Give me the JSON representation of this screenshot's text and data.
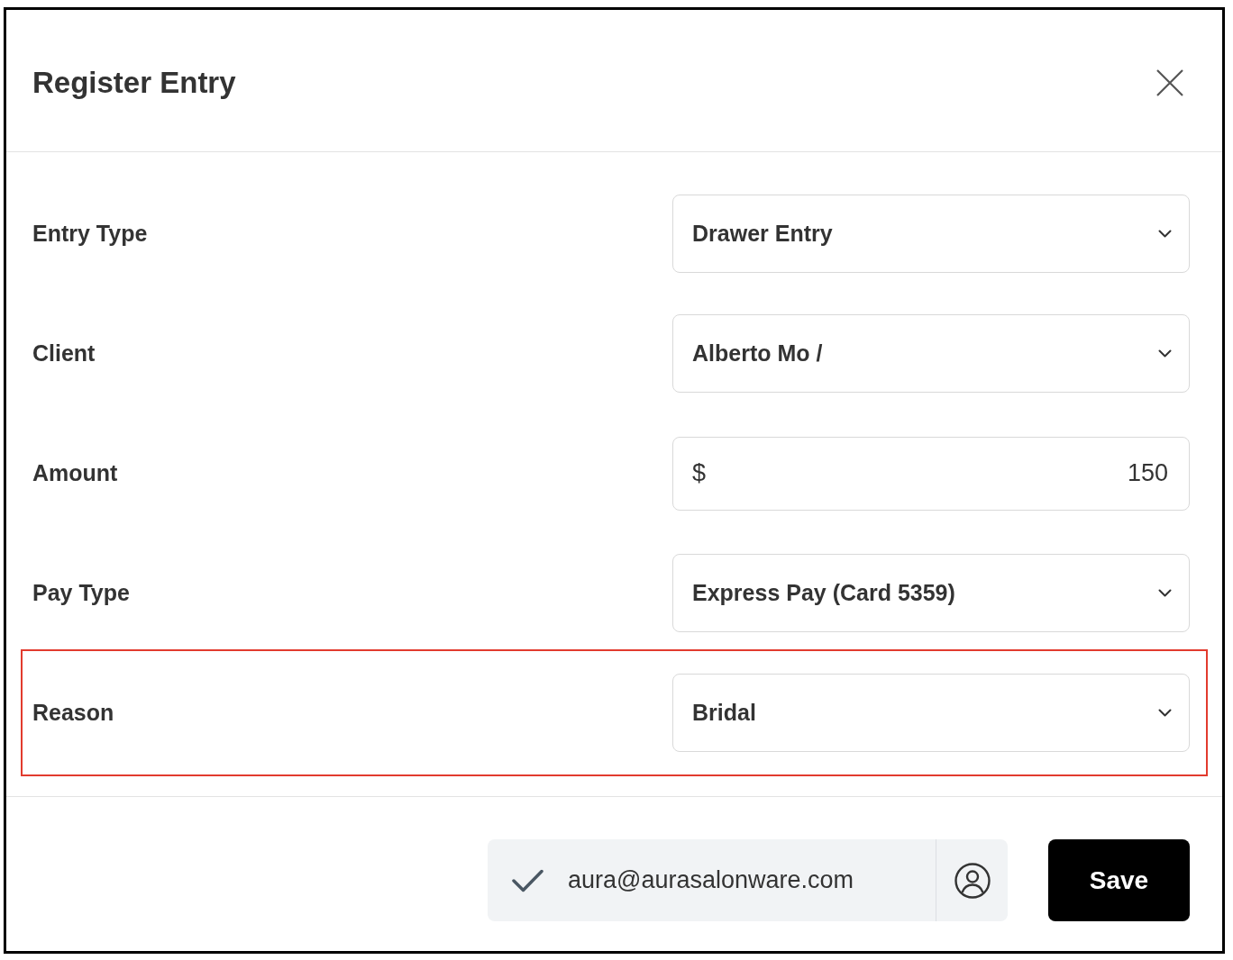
{
  "dialog": {
    "title": "Register Entry"
  },
  "fields": [
    {
      "label": "Entry Type",
      "kind": "select",
      "value": "Drawer Entry",
      "highlighted": false
    },
    {
      "label": "Client",
      "kind": "select",
      "value": "Alberto Mo /",
      "highlighted": false
    },
    {
      "label": "Amount",
      "kind": "currency",
      "prefix": "$",
      "value": "150",
      "highlighted": false
    },
    {
      "label": "Pay Type",
      "kind": "select",
      "value": "Express Pay (Card 5359)",
      "highlighted": false
    },
    {
      "label": "Reason",
      "kind": "select",
      "value": "Bridal",
      "highlighted": true
    }
  ],
  "footer": {
    "account": {
      "email": "aura@aurasalonware.com"
    },
    "save_button": {
      "label": "Save"
    }
  }
}
